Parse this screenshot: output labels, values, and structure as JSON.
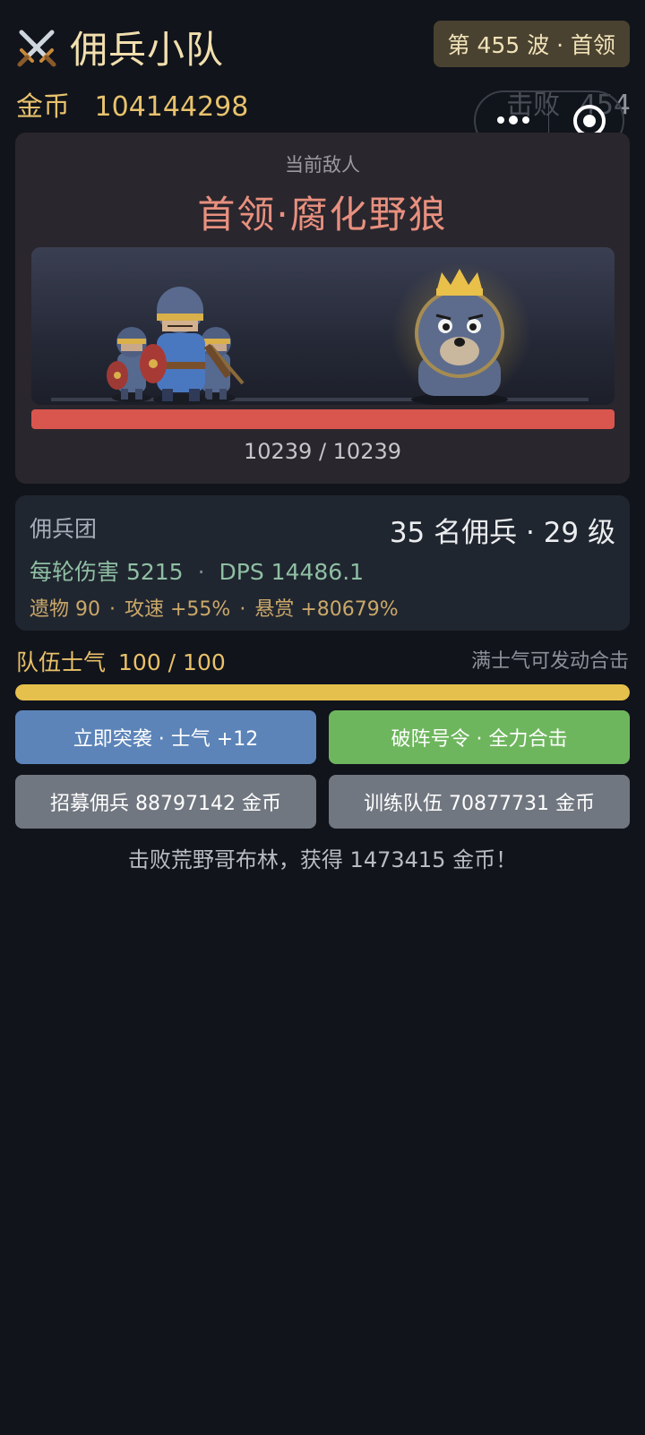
{
  "header": {
    "title_icon": "crossed-swords-icon",
    "title": "佣兵小队",
    "wave_badge": "第 455 波 · 首领",
    "gold_label": "金币",
    "gold_value": "104144298",
    "defeat_label": "击败",
    "defeat_value": "454"
  },
  "capsule": {
    "more_icon": "more-dots-icon",
    "close_icon": "target-icon"
  },
  "enemy": {
    "section_label": "当前敌人",
    "name": "首领·腐化野狼",
    "hp_current": 10239,
    "hp_max": 10239,
    "hp_text": "10239 / 10239",
    "hp_fraction": 1.0
  },
  "mercenaries": {
    "title": "佣兵团",
    "summary": "35 名佣兵 · 29 级",
    "damage": "每轮伤害 5215",
    "dps": "DPS 14486.1",
    "relics": "遗物 90",
    "attack_speed": "攻速 +55%",
    "bounty": "悬赏 +80679%"
  },
  "morale": {
    "label": "队伍士气",
    "value": "100 / 100",
    "hint": "满士气可发动合击",
    "fraction": 1.0
  },
  "actions": {
    "raid": "立即突袭 · 士气 +12",
    "order": "破阵号令 · 全力合击",
    "recruit": "招募佣兵  88797142 金币",
    "train": "训练队伍  70877731 金币"
  },
  "log": "击败荒野哥布林，获得 1473415 金币！",
  "colors": {
    "background": "#11141b",
    "accent_gold": "#e8c26d",
    "hp_bar": "#d9564f",
    "morale_bar": "#e6c04c",
    "raid_button": "#5c84b8",
    "order_button": "#6eb65e",
    "neutral_button": "#717780"
  }
}
